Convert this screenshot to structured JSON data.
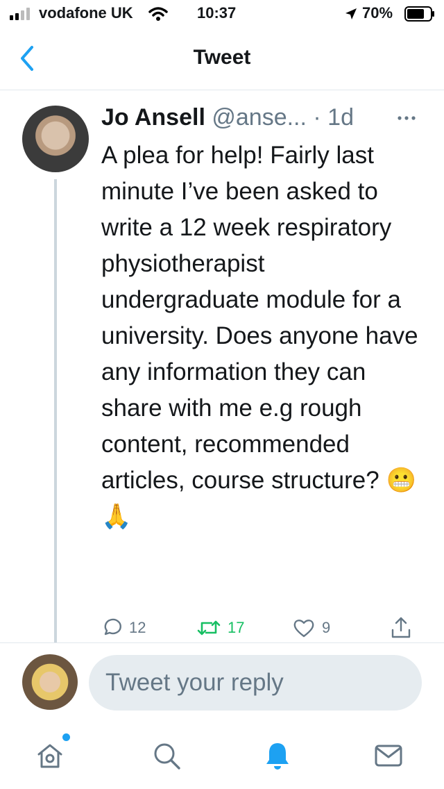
{
  "status_bar": {
    "carrier": "vodafone UK",
    "time": "10:37",
    "battery": "70%"
  },
  "nav": {
    "title": "Tweet",
    "back_icon": "chevron-left-icon"
  },
  "tweet": {
    "author_name": "Jo Ansell",
    "author_handle": "@anse...",
    "time": " · 1d",
    "text": "A plea for help! Fairly last minute I’ve been asked to write a 12 week respiratory physiotherapist undergraduate module for a university. Does anyone have any information they can share with me e.g rough content, recommended articles, course structure?",
    "emoji": "😬🙏",
    "replies": "12",
    "retweets": "17",
    "likes": "9"
  },
  "reply": {
    "placeholder": "Tweet your reply"
  },
  "tabs": [
    {
      "name": "home",
      "icon": "home-icon"
    },
    {
      "name": "search",
      "icon": "search-icon"
    },
    {
      "name": "notifications",
      "icon": "bell-icon"
    },
    {
      "name": "messages",
      "icon": "mail-icon"
    }
  ],
  "colors": {
    "accent": "#1da1f2",
    "retweet": "#17bf63",
    "secondary_text": "#657786"
  }
}
